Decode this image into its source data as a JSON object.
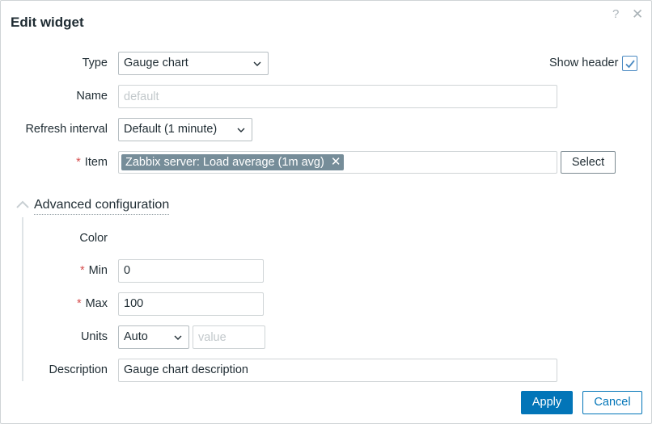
{
  "dialog": {
    "title": "Edit widget",
    "help_glyph": "?",
    "close_glyph": "✕"
  },
  "form": {
    "type": {
      "label": "Type",
      "value": "Gauge chart"
    },
    "show_header": {
      "label": "Show header",
      "checked": true
    },
    "name": {
      "label": "Name",
      "value": "",
      "placeholder": "default"
    },
    "refresh_interval": {
      "label": "Refresh interval",
      "value": "Default (1 minute)"
    },
    "item": {
      "required_mark": "*",
      "label": "Item",
      "selected": "Zabbix server: Load average (1m avg)",
      "remove_glyph": "✕",
      "select_button": "Select"
    }
  },
  "advanced": {
    "title": "Advanced configuration",
    "expanded": true,
    "color": {
      "label": "Color"
    },
    "min": {
      "required_mark": "*",
      "label": "Min",
      "value": "0"
    },
    "max": {
      "required_mark": "*",
      "label": "Max",
      "value": "100"
    },
    "units": {
      "label": "Units",
      "value": "Auto",
      "value_placeholder": "value"
    },
    "description": {
      "label": "Description",
      "value": "Gauge chart description"
    }
  },
  "footer": {
    "apply": "Apply",
    "cancel": "Cancel"
  },
  "colors": {
    "primary": "#0275b8",
    "tag_bg": "#768d99",
    "required": "#d64e4e",
    "border": "#cfd4d6"
  }
}
